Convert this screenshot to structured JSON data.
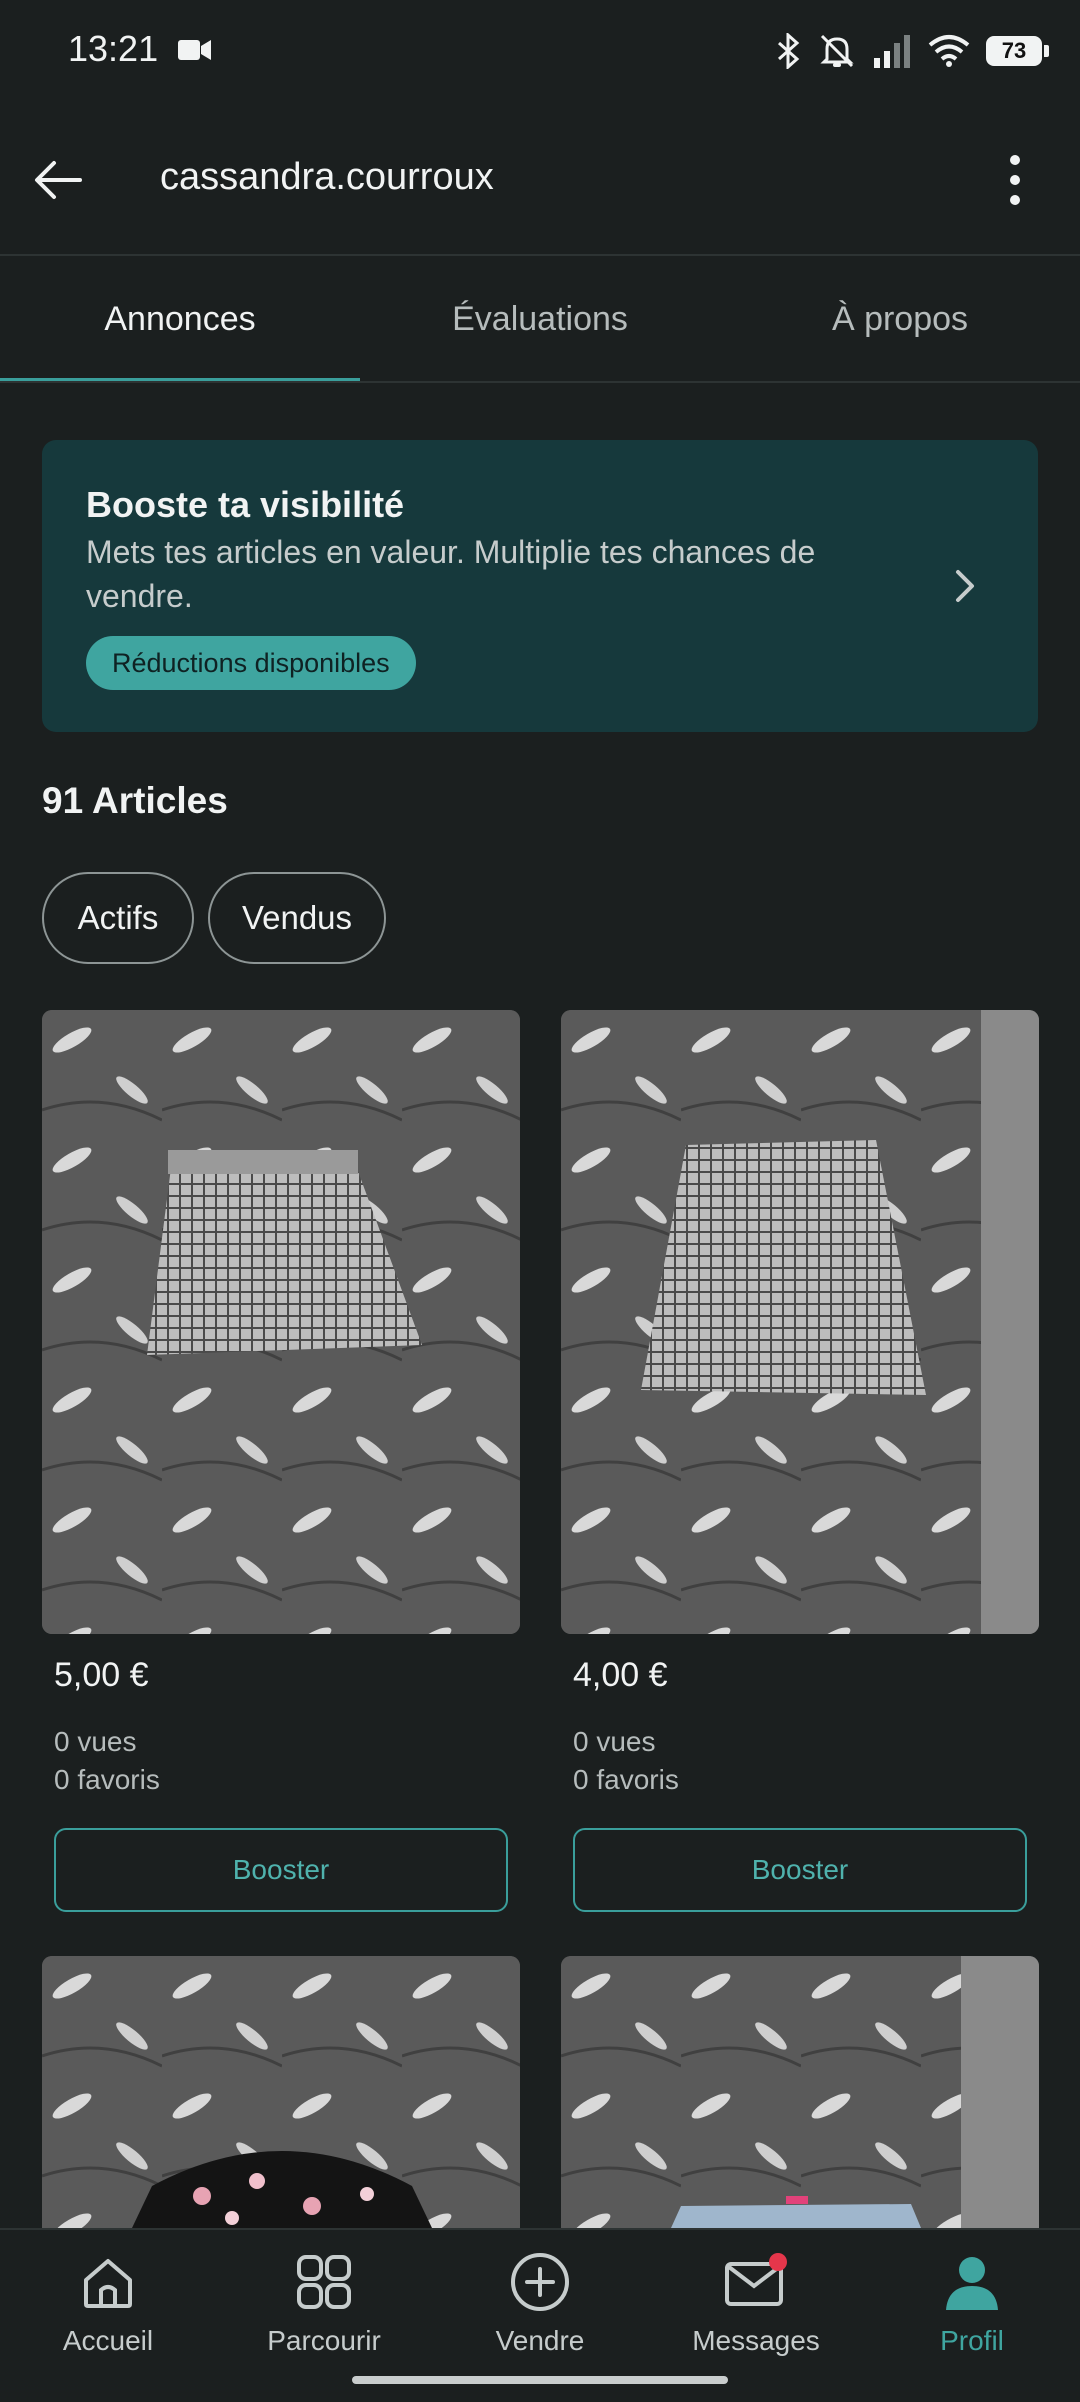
{
  "status_bar": {
    "time": "13:21",
    "battery": "73"
  },
  "header": {
    "title": "cassandra.courroux"
  },
  "tabs": [
    {
      "label": "Annonces",
      "active": true
    },
    {
      "label": "Évaluations",
      "active": false
    },
    {
      "label": "À propos",
      "active": false
    }
  ],
  "boost_card": {
    "title": "Booste ta visibilité",
    "body": "Mets tes articles en valeur. Multiplie tes chances de vendre.",
    "pill": "Réductions disponibles"
  },
  "articles": {
    "count_label": "91 Articles"
  },
  "filters": [
    {
      "label": "Actifs"
    },
    {
      "label": "Vendus"
    }
  ],
  "items": [
    {
      "price": "5,00 €",
      "views": "0 vues",
      "favorites": "0 favoris",
      "button": "Booster"
    },
    {
      "price": "4,00 €",
      "views": "0 vues",
      "favorites": "0 favoris",
      "button": "Booster"
    }
  ],
  "bottom_nav": [
    {
      "label": "Accueil",
      "icon": "home-icon"
    },
    {
      "label": "Parcourir",
      "icon": "grid-icon"
    },
    {
      "label": "Vendre",
      "icon": "plus-circle-icon"
    },
    {
      "label": "Messages",
      "icon": "mail-icon"
    },
    {
      "label": "Profil",
      "icon": "profile-icon",
      "active": true
    }
  ],
  "colors": {
    "accent": "#3fa5a0",
    "background": "#1b1f1f",
    "card": "#16393c",
    "badge": "#e5364b"
  }
}
